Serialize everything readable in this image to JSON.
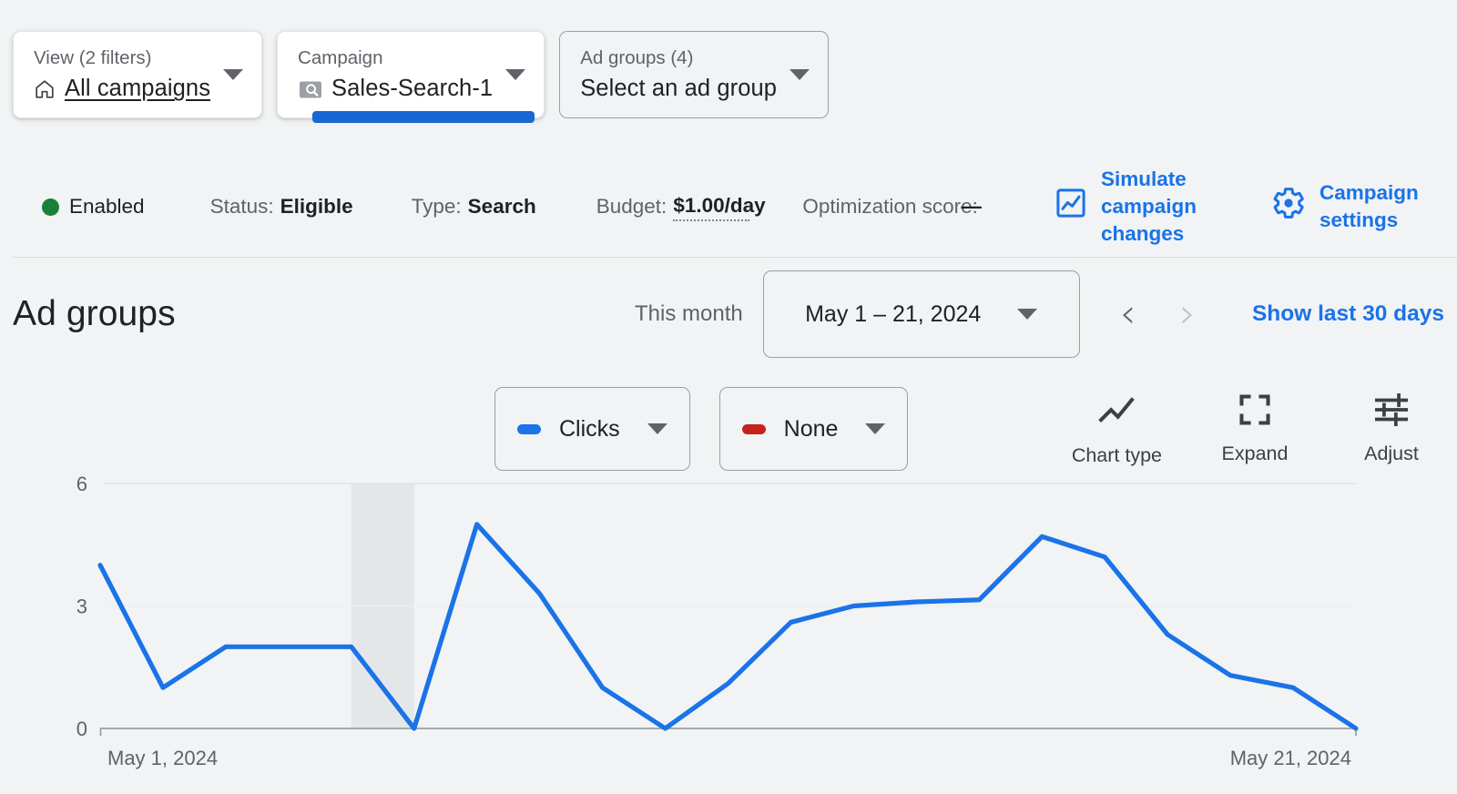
{
  "selectors": [
    {
      "id": "view",
      "label": "View (2 filters)",
      "value": "All campaigns",
      "icon": "home-icon",
      "style": "card",
      "underlined": true,
      "active": false
    },
    {
      "id": "campaign",
      "label": "Campaign",
      "value": "Sales-Search-1",
      "icon": "campaign-search-icon",
      "style": "card",
      "underlined": false,
      "active": true
    },
    {
      "id": "adgroups",
      "label": "Ad groups (4)",
      "value": "Select an ad group",
      "icon": null,
      "style": "outline",
      "underlined": false,
      "active": false
    }
  ],
  "status_strip": {
    "enabled_label": "Enabled",
    "enabled_dot_color": "#188038",
    "items": [
      {
        "key": "Status:",
        "value": "Eligible",
        "dotted": false
      },
      {
        "key": "Type:",
        "value": "Search",
        "dotted": false
      },
      {
        "key": "Budget:",
        "value": "$1.00/day",
        "dotted": true
      }
    ],
    "optimization": {
      "key": "Optimization score:",
      "value": "—"
    },
    "actions": [
      {
        "id": "simulate",
        "icon": "chart-box-icon",
        "label": "Simulate campaign changes"
      },
      {
        "id": "settings",
        "icon": "gear-icon",
        "label": "Campaign settings"
      }
    ],
    "link_color": "#1a73e8"
  },
  "ad_groups_header": {
    "title": "Ad groups",
    "range_preset": "This month",
    "date_range": "May 1 – 21, 2024",
    "prev_label": "‹",
    "next_label": "›",
    "show_last_30": "Show last 30 days"
  },
  "chart_toolbar": {
    "metrics": [
      {
        "id": "metric-1",
        "label": "Clicks",
        "color": "#1a73e8"
      },
      {
        "id": "metric-2",
        "label": "None",
        "color": "#c5221f"
      }
    ],
    "tools": [
      {
        "id": "chart-type",
        "icon": "line-chart-icon",
        "label": "Chart type"
      },
      {
        "id": "expand",
        "icon": "expand-icon",
        "label": "Expand"
      },
      {
        "id": "adjust",
        "icon": "tune-icon",
        "label": "Adjust"
      }
    ]
  },
  "chart_data": {
    "type": "line",
    "title": "",
    "xlabel": "",
    "ylabel": "",
    "series": [
      {
        "name": "Clicks",
        "color": "#1a73e8",
        "values": [
          4,
          1,
          2,
          2,
          2,
          0,
          5,
          3.3,
          1,
          0,
          1.1,
          2.6,
          3,
          3.1,
          3.15,
          4.7,
          4.2,
          2.3,
          1.3,
          1,
          0
        ]
      }
    ],
    "x": [
      "May 1, 2024",
      "May 2, 2024",
      "May 3, 2024",
      "May 4, 2024",
      "May 5, 2024",
      "May 6, 2024",
      "May 7, 2024",
      "May 8, 2024",
      "May 9, 2024",
      "May 10, 2024",
      "May 11, 2024",
      "May 12, 2024",
      "May 13, 2024",
      "May 14, 2024",
      "May 15, 2024",
      "May 16, 2024",
      "May 17, 2024",
      "May 18, 2024",
      "May 19, 2024",
      "May 20, 2024",
      "May 21, 2024"
    ],
    "x_tick_labels": [
      "May 1, 2024",
      "May 21, 2024"
    ],
    "y_ticks": [
      0,
      3,
      6
    ],
    "ylim": [
      0,
      6
    ],
    "grid": true,
    "legend_position": "top",
    "shaded_band": {
      "from_index": 4,
      "to_index": 5,
      "color": "#e4e7e9"
    }
  }
}
